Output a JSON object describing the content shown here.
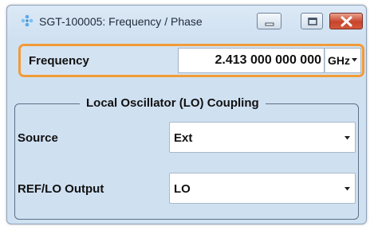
{
  "window": {
    "title": "SGT-100005: Frequency / Phase",
    "controls": {
      "minimize_icon": "minimize-icon",
      "maximize_icon": "restore-icon",
      "close_icon": "close-icon"
    }
  },
  "frequency": {
    "label": "Frequency",
    "value": "2.413 000 000 000",
    "unit": "GHz",
    "focus_color": "#f29b36"
  },
  "lo_coupling": {
    "title": "Local Oscillator (LO) Coupling",
    "source": {
      "label": "Source",
      "value": "Ext"
    },
    "ref_lo_output": {
      "label": "REF/LO Output",
      "value": "LO"
    }
  }
}
